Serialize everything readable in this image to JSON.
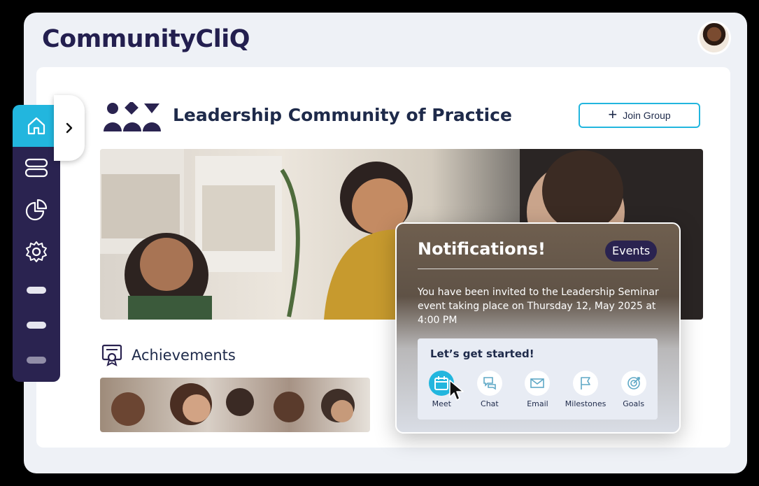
{
  "app": {
    "brand": "CommunityCliQ"
  },
  "header": {
    "avatar_alt": "user-avatar"
  },
  "group": {
    "title": "Leadership Community of Practice",
    "join_label": "Join Group"
  },
  "achievements": {
    "title": "Achievements"
  },
  "sidebar": {
    "items": [
      {
        "name": "home-icon",
        "active": true
      },
      {
        "name": "layout-icon",
        "active": false
      },
      {
        "name": "pie-chart-icon",
        "active": false
      },
      {
        "name": "gear-icon",
        "active": false
      }
    ],
    "placeholders": 3
  },
  "notification": {
    "title": "Notifications!",
    "badge": "Events",
    "message": "You have been invited to the Leadership Seminar event taking place on Thursday 12, May 2025 at 4:00 PM",
    "cta_title": "Let’s get started!",
    "actions": [
      {
        "label": "Meet",
        "icon": "calendar-icon",
        "active": true
      },
      {
        "label": "Chat",
        "icon": "chat-icon",
        "active": false
      },
      {
        "label": "Email",
        "icon": "mail-icon",
        "active": false
      },
      {
        "label": "Milestones",
        "icon": "flag-icon",
        "active": false
      },
      {
        "label": "Goals",
        "icon": "target-icon",
        "active": false
      }
    ]
  },
  "colors": {
    "accent": "#22b6de",
    "navy": "#2a2350",
    "text": "#1e2a4a"
  }
}
